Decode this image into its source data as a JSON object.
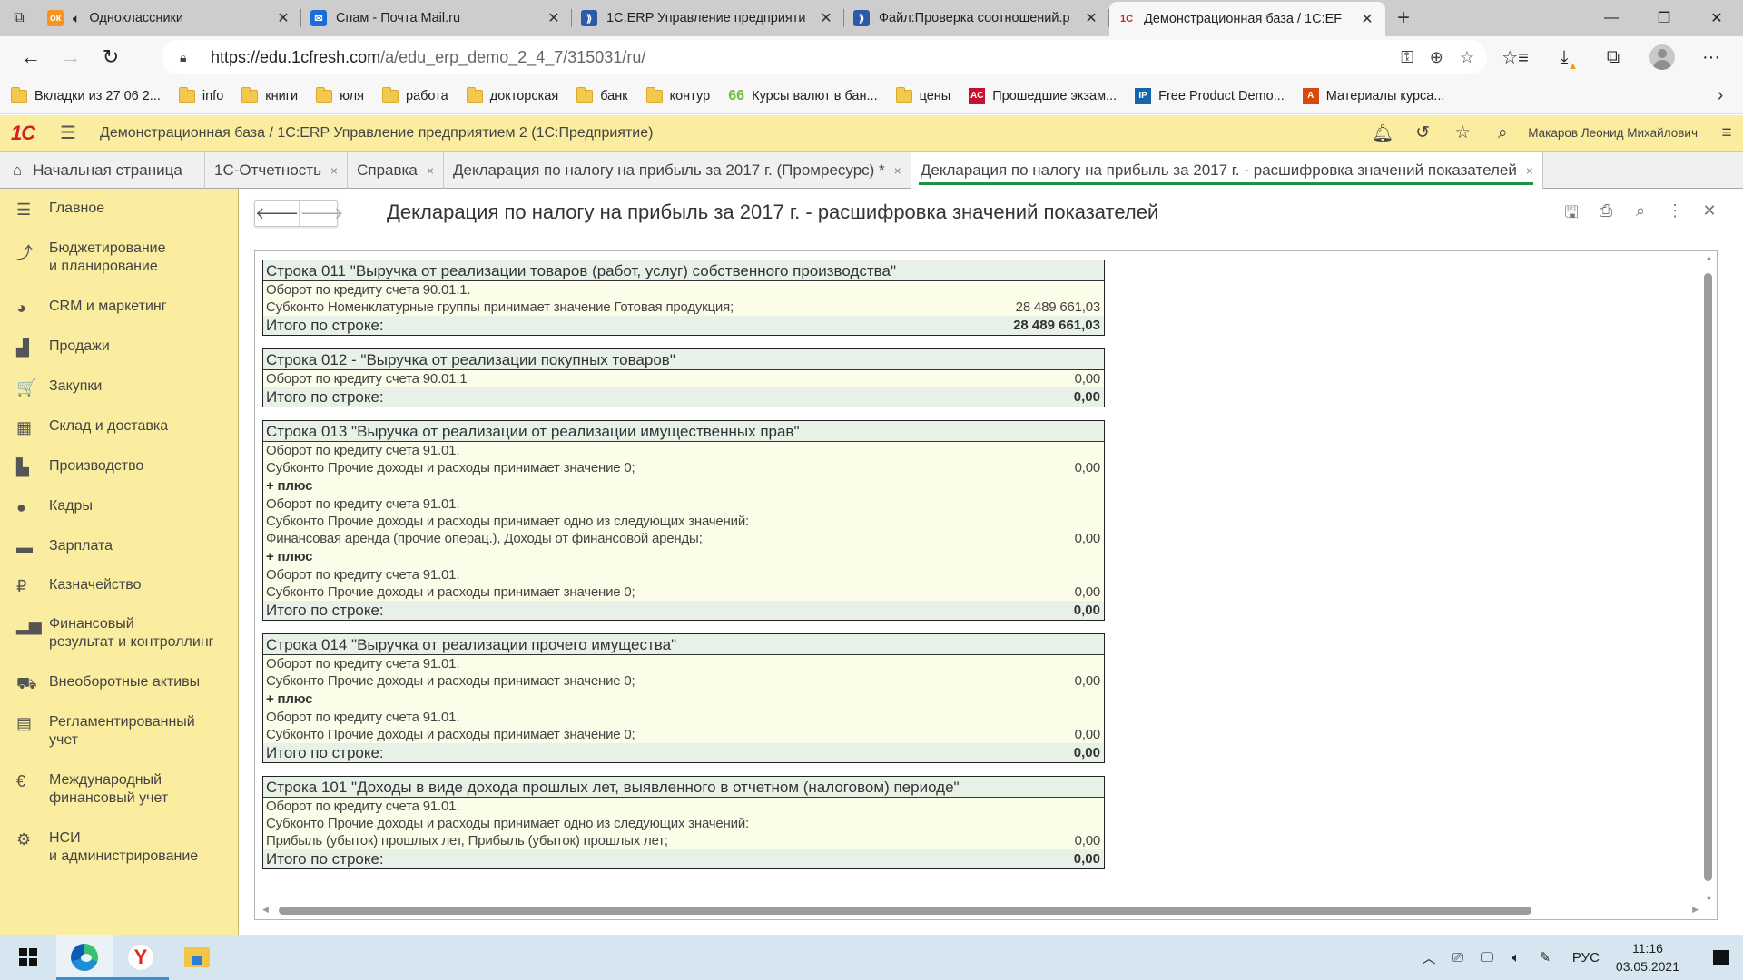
{
  "browser": {
    "tabs": [
      {
        "title": "Одноклассники",
        "favicon": "ok-icon",
        "favicon_color": "#f7931e",
        "audio": true
      },
      {
        "title": "Спам - Почта Mail.ru",
        "favicon": "mail-ru-icon",
        "favicon_color": "#1a6dd8"
      },
      {
        "title": "1С:ERP Управление предприяти",
        "favicon": "wiki-books-icon",
        "favicon_color": "#2b5aa8"
      },
      {
        "title": "Файл:Проверка соотношений.р",
        "favicon": "wiki-books-icon",
        "favicon_color": "#2b5aa8"
      },
      {
        "title": "Демонстрационная база / 1С:EF",
        "favicon": "1c-icon",
        "favicon_color": "#d32027",
        "active": true
      }
    ],
    "new_tab_label": "+",
    "url_host": "https://edu.1cfresh.com",
    "url_path": "/a/edu_erp_demo_2_4_7/315031/ru/",
    "bookmarks": [
      {
        "label": "Вкладки из 27 06 2...",
        "icon": "folder-icon"
      },
      {
        "label": "info",
        "icon": "folder-icon"
      },
      {
        "label": "книги",
        "icon": "folder-icon"
      },
      {
        "label": "юля",
        "icon": "folder-icon"
      },
      {
        "label": "работа",
        "icon": "folder-icon"
      },
      {
        "label": "докторская",
        "icon": "folder-icon"
      },
      {
        "label": "банк",
        "icon": "folder-icon"
      },
      {
        "label": "контур",
        "icon": "folder-icon"
      },
      {
        "label": "Курсы валют в бан...",
        "icon": "currency-site-icon",
        "color": "#6cbf3b"
      },
      {
        "label": "цены",
        "icon": "folder-icon"
      },
      {
        "label": "Прошедшие экзам...",
        "icon": "acca-icon",
        "color": "#c8102e"
      },
      {
        "label": "Free Product Demo...",
        "icon": "ip-icon",
        "color": "#1565a8"
      },
      {
        "label": "Материалы курса...",
        "icon": "a-icon",
        "color": "#d9480f"
      }
    ]
  },
  "app": {
    "title": "Демонстрационная база / 1С:ERP Управление предприятием 2  (1С:Предприятие)",
    "user": "Макаров Леонид Михайлович",
    "section_tabs": [
      {
        "label": "Начальная страница",
        "home": true
      },
      {
        "label": "1С-Отчетность",
        "closable": true
      },
      {
        "label": "Справка",
        "closable": true
      },
      {
        "label": "Декларация по налогу на прибыль за 2017 г. (Промресурс) *",
        "closable": true
      },
      {
        "label": "Декларация по налогу на прибыль за 2017 г. - расшифровка значений показателей",
        "closable": true,
        "active": true
      }
    ],
    "sidebar": [
      {
        "label": "Главное",
        "icon": "menu-lines-icon",
        "glyph": "☰"
      },
      {
        "label": "Бюджетирование\nи планирование",
        "icon": "budget-chart-icon",
        "glyph": "⤴"
      },
      {
        "label": "CRM и маркетинг",
        "icon": "pie-chart-icon",
        "glyph": "◕"
      },
      {
        "label": "Продажи",
        "icon": "shopping-bag-icon",
        "glyph": "▟"
      },
      {
        "label": "Закупки",
        "icon": "cart-icon",
        "glyph": "🛒"
      },
      {
        "label": "Склад и доставка",
        "icon": "warehouse-icon",
        "glyph": "▦"
      },
      {
        "label": "Производство",
        "icon": "factory-icon",
        "glyph": "▙"
      },
      {
        "label": "Кадры",
        "icon": "person-icon",
        "glyph": "●"
      },
      {
        "label": "Зарплата",
        "icon": "card-icon",
        "glyph": "▬"
      },
      {
        "label": "Казначейство",
        "icon": "ruble-icon",
        "glyph": "₽"
      },
      {
        "label": "Финансовый\nрезультат и контроллинг",
        "icon": "bar-chart-icon",
        "glyph": "▂▅"
      },
      {
        "label": "Внеоборотные активы",
        "icon": "truck-icon",
        "glyph": "⛟"
      },
      {
        "label": "Регламентированный\nучет",
        "icon": "calculator-icon",
        "glyph": "▤"
      },
      {
        "label": "Международный\nфинансовый учет",
        "icon": "euro-icon",
        "glyph": "€"
      },
      {
        "label": "НСИ\nи администрирование",
        "icon": "gear-icon",
        "glyph": "⚙"
      }
    ]
  },
  "form": {
    "title": "Декларация по налогу на прибыль за 2017 г. - расшифровка значений показателей",
    "blocks": [
      {
        "header": "Строка 011 \"Выручка от реализации товаров (работ, услуг) собственного производства\"",
        "rows": [
          {
            "text": "Оборот по кредиту счета 90.01.1.",
            "value": ""
          },
          {
            "text": "Субконто Номенклатурные группы принимает значение Готовая продукция;",
            "value": "28 489 661,03"
          }
        ],
        "total_label": "Итого по строке:",
        "total_value": "28 489 661,03"
      },
      {
        "header": "Строка 012 - \"Выручка от реализации покупных товаров\"",
        "rows": [
          {
            "text": "Оборот по кредиту счета 90.01.1",
            "value": "0,00"
          }
        ],
        "total_label": "Итого по строке:",
        "total_value": "0,00"
      },
      {
        "header": "Строка 013 \"Выручка от реализации от реализации имущественных прав\"",
        "rows": [
          {
            "text": "Оборот по кредиту счета 91.01.",
            "value": ""
          },
          {
            "text": "Субконто Прочие доходы и расходы принимает значение 0;",
            "value": "0,00"
          },
          {
            "text": "+ плюс",
            "value": "",
            "plus": true
          },
          {
            "text": "Оборот по кредиту счета 91.01.",
            "value": ""
          },
          {
            "text": "Субконто Прочие доходы и расходы принимает одно из следующих значений:",
            "value": ""
          },
          {
            "text": "Финансовая аренда (прочие операц.), Доходы от финансовой аренды;",
            "value": "0,00"
          },
          {
            "text": "+ плюс",
            "value": "",
            "plus": true
          },
          {
            "text": "Оборот по кредиту счета 91.01.",
            "value": ""
          },
          {
            "text": "Субконто Прочие доходы и расходы принимает значение 0;",
            "value": "0,00"
          }
        ],
        "total_label": "Итого по строке:",
        "total_value": "0,00"
      },
      {
        "header": "Строка 014 \"Выручка от реализации прочего имущества\"",
        "rows": [
          {
            "text": "Оборот по кредиту счета 91.01.",
            "value": ""
          },
          {
            "text": "Субконто Прочие доходы и расходы принимает значение 0;",
            "value": "0,00"
          },
          {
            "text": "+ плюс",
            "value": "",
            "plus": true
          },
          {
            "text": "Оборот по кредиту счета 91.01.",
            "value": ""
          },
          {
            "text": "Субконто Прочие доходы и расходы принимает значение 0;",
            "value": "0,00"
          }
        ],
        "total_label": "Итого по строке:",
        "total_value": "0,00"
      },
      {
        "header": "Строка 101 \"Доходы в виде дохода прошлых лет, выявленного в отчетном (налоговом) периоде\"",
        "rows": [
          {
            "text": "Оборот по кредиту счета 91.01.",
            "value": ""
          },
          {
            "text": "Субконто Прочие доходы и расходы принимает одно из следующих значений:",
            "value": ""
          },
          {
            "text": "Прибыль (убыток) прошлых лет, Прибыль (убыток) прошлых лет;",
            "value": "0,00"
          }
        ],
        "total_label": "Итого по строке:",
        "total_value": "0,00"
      }
    ]
  },
  "taskbar": {
    "language": "РУС",
    "time": "11:16",
    "date": "03.05.2021"
  }
}
